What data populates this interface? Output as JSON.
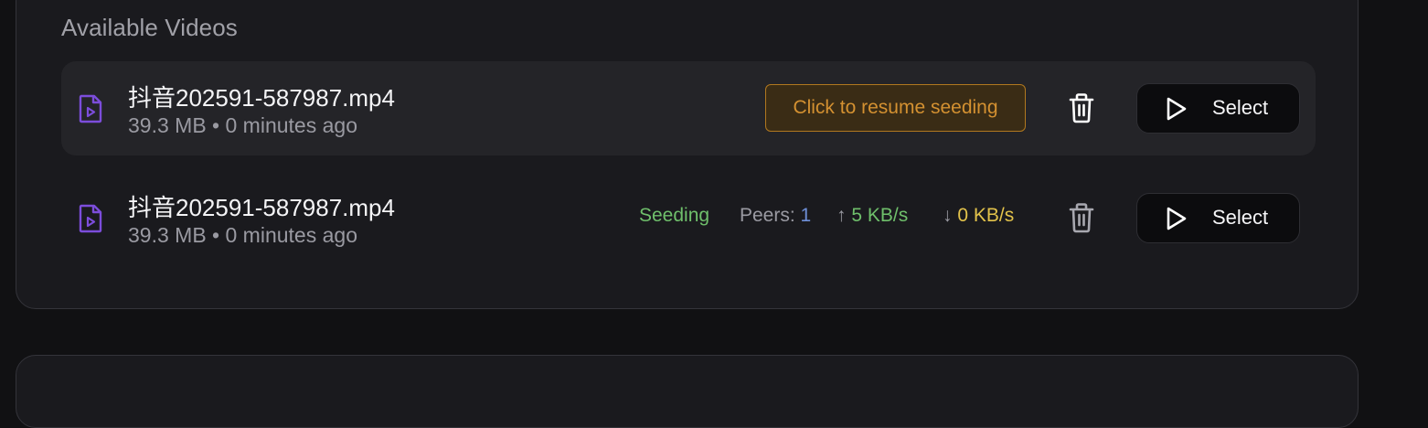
{
  "section": {
    "title": "Available Videos"
  },
  "videos": [
    {
      "name": "抖音202591-587987.mp4",
      "size": "39.3 MB",
      "separator": "•",
      "time": "0 minutes ago",
      "action": "Click to resume seeding",
      "select_label": "Select",
      "icon": "file-video-icon"
    },
    {
      "name": "抖音202591-587987.mp4",
      "size": "39.3 MB",
      "separator": "•",
      "time": "0 minutes ago",
      "status": "Seeding",
      "peers_label": "Peers:",
      "peers": "1",
      "up_arrow": "↑",
      "upload": "5 KB/s",
      "down_arrow": "↓",
      "download": "0 KB/s",
      "select_label": "Select",
      "icon": "file-video-icon"
    }
  ],
  "colors": {
    "panel": "#1a1a1e",
    "accent_purple": "#7c4ddb",
    "resume_orange": "#d49131",
    "seeding_green": "#6fbf6b",
    "peers_blue": "#6e8fd8",
    "download_yellow": "#e2c24b"
  }
}
